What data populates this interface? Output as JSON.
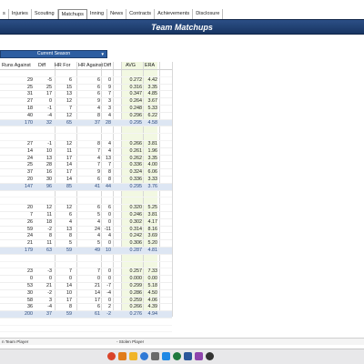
{
  "tabs": [
    "s",
    "Injuries",
    "Scouting",
    "Matchups",
    "Inning",
    "News",
    "Contracts",
    "Achievements",
    "Disclosure"
  ],
  "active_tab": "Matchups",
  "banner_title": "Team Matchups",
  "season_select": {
    "value": "Current Season"
  },
  "columns": [
    "Runs Against",
    "Diff",
    "HR For",
    "HR Against",
    "Diff",
    "AVG",
    "ERA"
  ],
  "rows": [
    {
      "type": "blank"
    },
    {
      "type": "data",
      "cells": [
        "29",
        "-5",
        "6",
        "6",
        "0",
        "0.272",
        "4.42"
      ]
    },
    {
      "type": "data",
      "cells": [
        "25",
        "25",
        "15",
        "6",
        "9",
        "0.316",
        "3.35"
      ]
    },
    {
      "type": "data",
      "cells": [
        "31",
        "17",
        "13",
        "6",
        "7",
        "0.347",
        "4.85"
      ]
    },
    {
      "type": "data",
      "cells": [
        "27",
        "0",
        "12",
        "9",
        "3",
        "0.264",
        "3.67"
      ]
    },
    {
      "type": "data",
      "cells": [
        "18",
        "-1",
        "7",
        "4",
        "3",
        "0.248",
        "5.33"
      ]
    },
    {
      "type": "data",
      "cells": [
        "40",
        "-4",
        "12",
        "8",
        "4",
        "0.296",
        "6.22"
      ]
    },
    {
      "type": "total",
      "cells": [
        "170",
        "32",
        "65",
        "37",
        "28",
        "0.295",
        "4.58"
      ]
    },
    {
      "type": "blank"
    },
    {
      "type": "blank"
    },
    {
      "type": "data",
      "cells": [
        "27",
        "-1",
        "12",
        "8",
        "4",
        "0.266",
        "3.81"
      ]
    },
    {
      "type": "data",
      "cells": [
        "14",
        "10",
        "11",
        "7",
        "4",
        "0.261",
        "1.96"
      ]
    },
    {
      "type": "data",
      "cells": [
        "24",
        "13",
        "17",
        "4",
        "13",
        "0.262",
        "3.35"
      ]
    },
    {
      "type": "data",
      "cells": [
        "25",
        "28",
        "14",
        "7",
        "7",
        "0.336",
        "4.00"
      ]
    },
    {
      "type": "data",
      "cells": [
        "37",
        "16",
        "17",
        "9",
        "8",
        "0.324",
        "6.06"
      ]
    },
    {
      "type": "data",
      "cells": [
        "20",
        "30",
        "14",
        "6",
        "8",
        "0.336",
        "3.33"
      ]
    },
    {
      "type": "total",
      "cells": [
        "147",
        "96",
        "85",
        "41",
        "44",
        "0.295",
        "3.76"
      ]
    },
    {
      "type": "blank"
    },
    {
      "type": "blank"
    },
    {
      "type": "data",
      "cells": [
        "20",
        "12",
        "12",
        "6",
        "6",
        "0.320",
        "5.25"
      ]
    },
    {
      "type": "data",
      "cells": [
        "7",
        "11",
        "6",
        "5",
        "0",
        "0.246",
        "3.81"
      ]
    },
    {
      "type": "data",
      "cells": [
        "26",
        "18",
        "4",
        "4",
        "0",
        "0.302",
        "4.17"
      ]
    },
    {
      "type": "data",
      "cells": [
        "59",
        "-2",
        "13",
        "24",
        "-11",
        "0.314",
        "8.16"
      ]
    },
    {
      "type": "data",
      "cells": [
        "24",
        "8",
        "8",
        "4",
        "4",
        "0.242",
        "3.69"
      ]
    },
    {
      "type": "data",
      "cells": [
        "21",
        "11",
        "5",
        "5",
        "0",
        "0.306",
        "5.20"
      ]
    },
    {
      "type": "total",
      "cells": [
        "179",
        "63",
        "59",
        "49",
        "10",
        "0.287",
        "4.81"
      ]
    },
    {
      "type": "blank"
    },
    {
      "type": "blank"
    },
    {
      "type": "data",
      "cells": [
        "23",
        "-3",
        "7",
        "7",
        "0",
        "0.257",
        "7.33"
      ]
    },
    {
      "type": "data",
      "cells": [
        "0",
        "0",
        "0",
        "0",
        "0",
        "0.000",
        "0.00"
      ]
    },
    {
      "type": "data",
      "cells": [
        "53",
        "21",
        "14",
        "21",
        "-7",
        "0.299",
        "5.18"
      ]
    },
    {
      "type": "data",
      "cells": [
        "30",
        "-2",
        "10",
        "14",
        "-4",
        "0.286",
        "4.50"
      ]
    },
    {
      "type": "data",
      "cells": [
        "58",
        "3",
        "17",
        "17",
        "0",
        "0.259",
        "4.06"
      ]
    },
    {
      "type": "data",
      "cells": [
        "36",
        "-4",
        "8",
        "6",
        "2",
        "0.266",
        "4.39"
      ]
    },
    {
      "type": "total",
      "cells": [
        "200",
        "37",
        "59",
        "61",
        "-2",
        "0.276",
        "4.94"
      ]
    },
    {
      "type": "blank"
    },
    {
      "type": "blank"
    }
  ],
  "sheet_tabs": [
    "n Team Player",
    "- Stolen Player"
  ],
  "colors": {
    "banner": "#1f3d6e",
    "total_row": "#dde6f3",
    "avg_band": "#f2f8e2"
  },
  "taskbar_icons": [
    "chrome-icon",
    "firefox-icon",
    "folder-icon",
    "mail-icon",
    "settings-icon",
    "store-icon",
    "excel-icon",
    "word-icon",
    "photos-icon",
    "terminal-icon"
  ]
}
